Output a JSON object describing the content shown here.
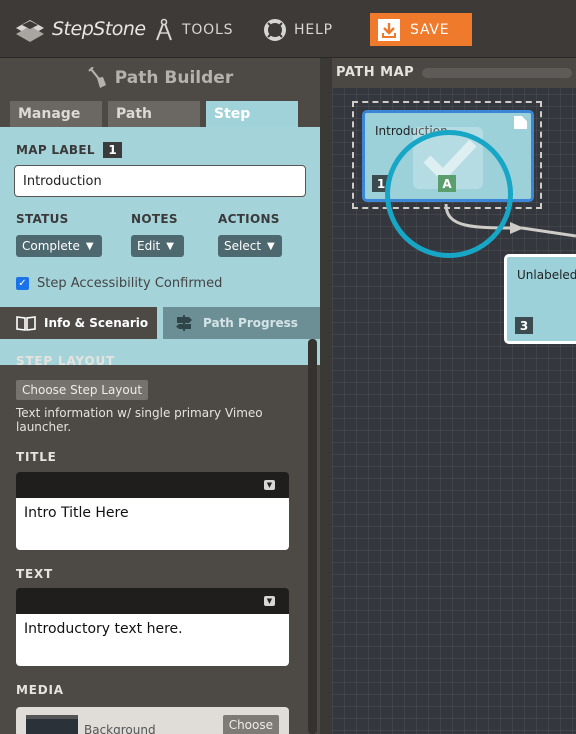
{
  "app": {
    "logo_text": "StepStone",
    "nav": {
      "tools_label": "TOOLS",
      "help_label": "HELP",
      "save_label": "SAVE"
    }
  },
  "sidebar": {
    "title": "Path Builder",
    "tabs": [
      {
        "label": "Manage",
        "active": false
      },
      {
        "label": "Path",
        "active": false
      },
      {
        "label": "Step",
        "active": true
      }
    ],
    "map_label": {
      "label": "MAP LABEL",
      "number": "1",
      "value": "Introduction"
    },
    "status": {
      "label": "STATUS",
      "value": "Complete"
    },
    "notes": {
      "label": "NOTES",
      "value": "Edit"
    },
    "actions": {
      "label": "ACTIONS",
      "value": "Select"
    },
    "accessibility": {
      "label": "Step Accessibility Confirmed",
      "checked": true
    },
    "subtabs": [
      {
        "label": "Info & Scenario",
        "active": true
      },
      {
        "label": "Path Progress",
        "active": false
      }
    ],
    "step_layout": {
      "label": "STEP LAYOUT",
      "button": "Choose Step Layout",
      "description": "Text information w/ single primary Vimeo launcher."
    },
    "title_field": {
      "label": "TITLE",
      "value": "Intro Title Here"
    },
    "text_field": {
      "label": "TEXT",
      "value": "Introductory text here."
    },
    "media": {
      "label": "MEDIA",
      "item_name": "Background",
      "choose_label": "Choose"
    }
  },
  "path_map": {
    "title": "PATH MAP",
    "nodes": [
      {
        "name": "Introduction",
        "number": "1",
        "badge": "A",
        "selected": true
      },
      {
        "name": "Unlabeled",
        "number": "3",
        "selected": false
      }
    ]
  },
  "colors": {
    "accent_teal": "#17a6c6",
    "save_orange": "#ef7a2c",
    "panel_teal": "#a4d3d9",
    "select_blue": "#3b86d6"
  }
}
